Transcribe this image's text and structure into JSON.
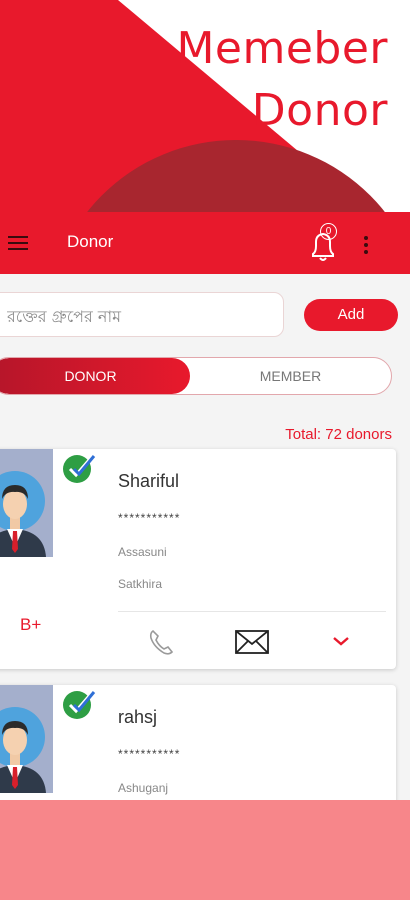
{
  "promo": {
    "line1": "Memeber",
    "line2": "Donor"
  },
  "appbar": {
    "title": "Donor",
    "notification_count": "0"
  },
  "search": {
    "placeholder": "রক্তের গ্রুপের নাম",
    "value": ""
  },
  "add_button": "Add",
  "segment": {
    "donor": "DONOR",
    "member": "MEMBER",
    "selected": "DONOR"
  },
  "total": "Total: 72 donors",
  "donors": [
    {
      "name": "Shariful",
      "phone": "***********",
      "thana": "Assasuni",
      "district": "Satkhira",
      "blood_group": "B+",
      "verified": true
    },
    {
      "name": "rahsj",
      "phone": "***********",
      "thana": "Ashuganj",
      "verified": true
    }
  ],
  "colors": {
    "accent": "#e8192c",
    "dark_red": "#a8262f",
    "pink": "#f7868a",
    "verified_green": "#2e9e44",
    "check_blue": "#2f6fd6"
  },
  "icons": [
    "menu-icon",
    "bell-icon",
    "more-vert-icon",
    "verified-icon",
    "phone-icon",
    "mail-icon",
    "chevron-down-icon"
  ]
}
